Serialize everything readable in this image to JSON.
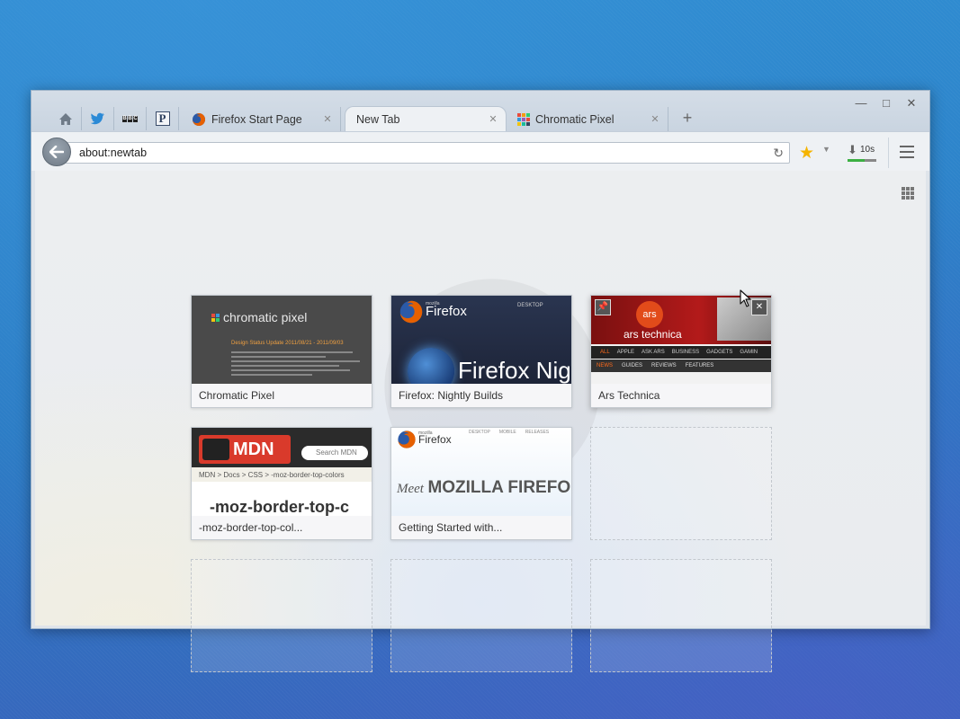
{
  "window": {
    "controls": {
      "minimize": "—",
      "maximize": "□",
      "close": "✕"
    }
  },
  "pinned_tabs": [
    {
      "name": "home-icon"
    },
    {
      "name": "twitter-icon"
    },
    {
      "name": "bbc-icon",
      "label": "BBC"
    },
    {
      "name": "pinboard-icon",
      "label": "P"
    }
  ],
  "tabs": [
    {
      "title": "Firefox Start Page",
      "icon": "firefox-icon",
      "close": "✕"
    },
    {
      "title": "New Tab",
      "close": "✕",
      "active": true
    },
    {
      "title": "Chromatic Pixel",
      "icon": "chromatic-pixel-icon",
      "close": "✕"
    }
  ],
  "new_tab_label": "+",
  "navbar": {
    "url": "about:newtab",
    "reload": "↻",
    "bookmark_star": "★",
    "bookmark_dropdown": "▼",
    "downloads_time": "10s",
    "downloads_progress": 0.6
  },
  "tiles": [
    {
      "title": "Chromatic Pixel",
      "thumb_heading": "chromatic pixel",
      "thumb_sub": "Design Status Update 2011/08/21 - 2011/09/03"
    },
    {
      "title": "Firefox: Nightly Builds",
      "thumb_brand": "Firefox",
      "thumb_brand_small": "mozilla",
      "thumb_nav": "DESKTOP",
      "thumb_big": "Firefox Nig"
    },
    {
      "title": "Ars Technica",
      "thumb_brand": "ars technica",
      "thumb_logo": "ars",
      "thumb_nav": [
        "ALL",
        "APPLE",
        "ASK ARS",
        "BUSINESS",
        "GADGETS",
        "GAMIN"
      ],
      "thumb_sub_nav": [
        "NEWS",
        "GUIDES",
        "REVIEWS",
        "FEATURES"
      ],
      "pin": "📌",
      "close": "✕"
    },
    {
      "title": "-moz-border-top-col...",
      "thumb_brand": "MDN",
      "thumb_search": "Search MDN",
      "thumb_breadcrumb": "MDN  >  Docs  >  CSS  >  -moz-border-top-colors",
      "thumb_big": "-moz-border-top-c"
    },
    {
      "title": "Getting Started with...",
      "thumb_brand": "Firefox",
      "thumb_brand_small": "mozilla",
      "thumb_nav": [
        "DESKTOP",
        "MOBILE",
        "RELEASES"
      ],
      "thumb_big_prefix": "Meet",
      "thumb_big": "MOZILLA FIREFO"
    }
  ]
}
